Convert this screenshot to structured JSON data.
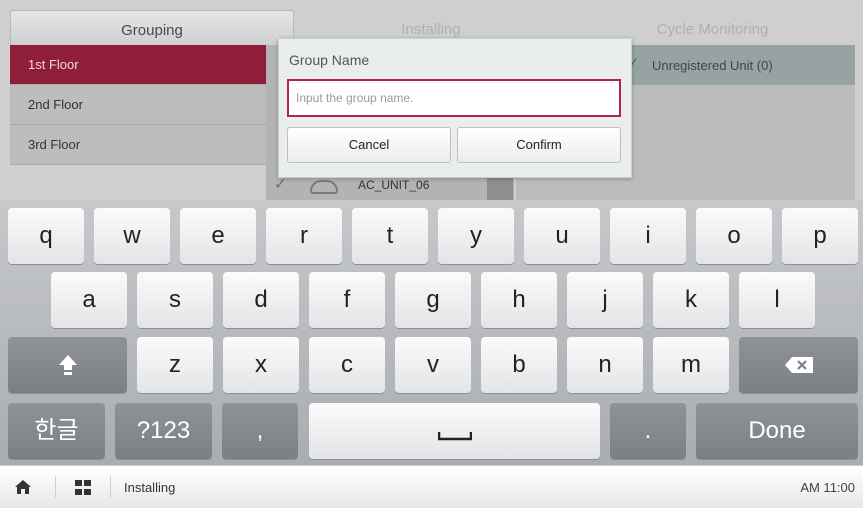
{
  "tabs": {
    "grouping": "Grouping",
    "installing": "Installing",
    "cycle_monitoring": "Cycle Monitoring"
  },
  "floors": [
    "1st Floor",
    "2nd Floor",
    "3rd Floor"
  ],
  "unit": {
    "name": "AC_UNIT_06"
  },
  "right_panel": {
    "header": "Unregistered Unit (0)"
  },
  "dialog": {
    "title": "Group Name",
    "input_value": "",
    "input_placeholder": "Input the group name.",
    "cancel_label": "Cancel",
    "confirm_label": "Confirm"
  },
  "keyboard": {
    "row1": [
      "q",
      "w",
      "e",
      "r",
      "t",
      "y",
      "u",
      "i",
      "o",
      "p"
    ],
    "row2": [
      "a",
      "s",
      "d",
      "f",
      "g",
      "h",
      "j",
      "k",
      "l"
    ],
    "row3": [
      "z",
      "x",
      "c",
      "v",
      "b",
      "n",
      "m"
    ],
    "row4": {
      "lang": "한글",
      "symbols": "?123",
      "comma": ",",
      "period": ".",
      "done": "Done"
    }
  },
  "statusbar": {
    "label": "Installing",
    "time": "AM 11:00"
  },
  "colors": {
    "accent": "#8f1f38",
    "input_border": "#b2254a"
  }
}
